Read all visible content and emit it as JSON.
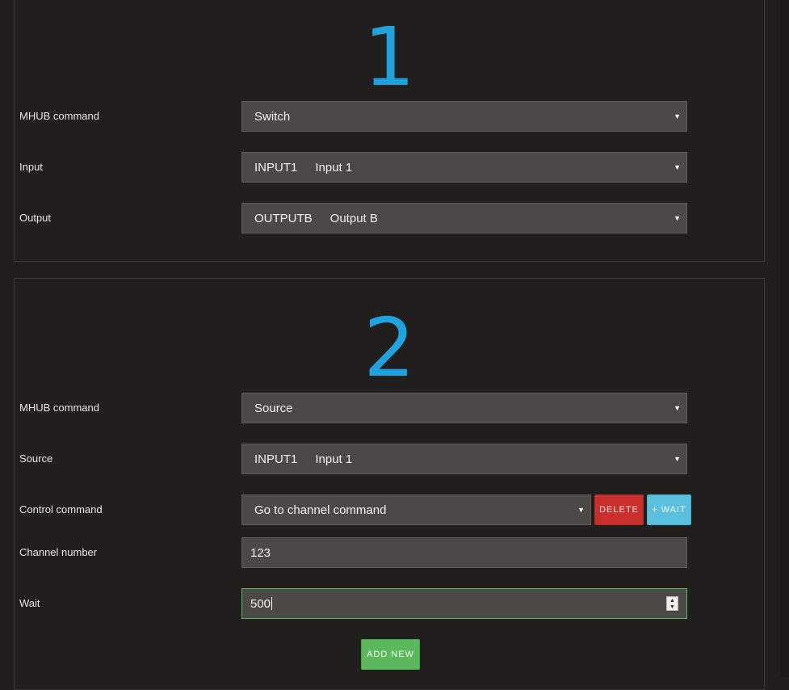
{
  "steps": [
    {
      "number": "1",
      "rows": [
        {
          "label": "MHUB command",
          "value": "Switch"
        },
        {
          "label": "Input",
          "code": "INPUT1",
          "name": "Input 1"
        },
        {
          "label": "Output",
          "code": "OUTPUTB",
          "name": "Output B"
        }
      ]
    },
    {
      "number": "2",
      "rows": [
        {
          "label": "MHUB command",
          "value": "Source"
        },
        {
          "label": "Source",
          "code": "INPUT1",
          "name": "Input 1"
        },
        {
          "label": "Control command",
          "value": "Go to channel command"
        },
        {
          "label": "Channel number",
          "value": "123"
        },
        {
          "label": "Wait",
          "value": "500"
        }
      ],
      "buttons": {
        "delete": "DELETE",
        "wait": "+ WAIT",
        "add_new": "ADD NEW"
      }
    }
  ],
  "colors": {
    "step_number": "#1fa3df",
    "delete": "#c9302c",
    "wait": "#5bc0de",
    "add": "#5cb85c",
    "background": "#211f1d"
  },
  "icons": {
    "dropdown": "caret-down-icon",
    "spinner": "number-spinner-icon"
  }
}
